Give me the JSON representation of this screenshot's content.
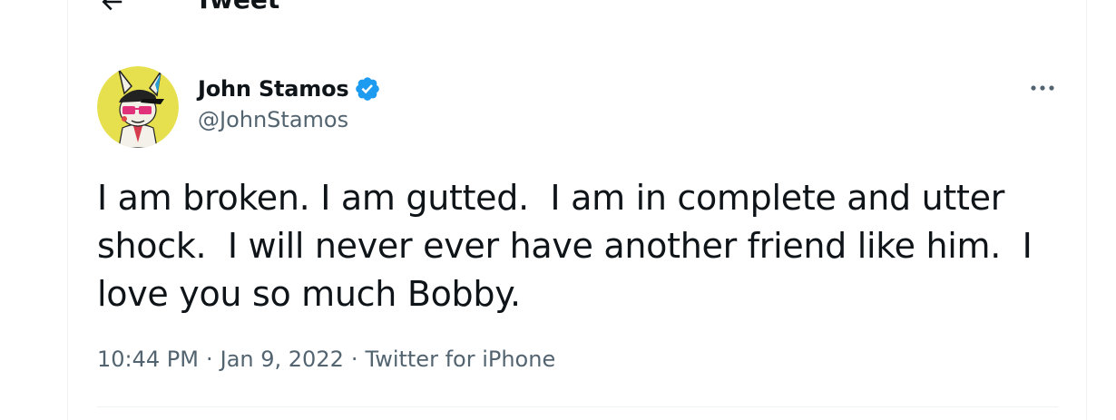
{
  "header": {
    "title": "Tweet",
    "back_icon": "arrow-left-icon"
  },
  "tweet": {
    "author": {
      "display_name": "John Stamos",
      "handle": "@JohnStamos",
      "verified": true,
      "avatar": "cartoon-bunny-avatar"
    },
    "text": "I am broken. I am gutted.  I am in complete and utter\nshock.  I will never ever have another friend like him.  I\nlove you so much Bobby.",
    "time": "10:44 PM",
    "date": "Jan 9, 2022",
    "source": "Twitter for iPhone",
    "separator": "·",
    "more_icon": "more-dots-icon"
  },
  "colors": {
    "text_primary": "#0f1419",
    "text_secondary": "#536471",
    "verified_blue": "#1d9bf0",
    "divider": "#eff3f4",
    "avatar_bg": "#e6e04f"
  }
}
